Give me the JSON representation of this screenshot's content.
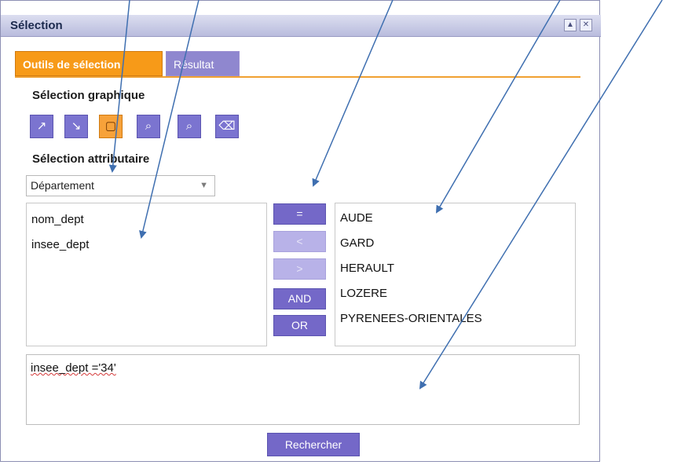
{
  "window": {
    "title": "Sélection",
    "minimize_icon": "▲",
    "close_icon": "✕"
  },
  "tabs": [
    {
      "label": "Outils de sélection",
      "active": true
    },
    {
      "label": "Résultat",
      "active": false
    }
  ],
  "graphic_section": {
    "title": "Sélection graphique",
    "tools": [
      {
        "icon": "point-select-icon",
        "glyph": "↗",
        "active": false
      },
      {
        "icon": "line-select-icon",
        "glyph": "↘",
        "active": false
      },
      {
        "icon": "rectangle-select-icon",
        "glyph": "▢",
        "active": true
      },
      {
        "icon": "polygon-select-icon",
        "glyph": "⌕",
        "active": false
      },
      {
        "icon": "freehand-select-icon",
        "glyph": "⌕",
        "active": false
      },
      {
        "icon": "eraser-icon",
        "glyph": "⌫",
        "active": false
      }
    ]
  },
  "attribute_section": {
    "title": "Sélection attributaire",
    "layer_select": {
      "value": "Département",
      "arrow": "▼"
    }
  },
  "fields": [
    "nom_dept",
    "insee_dept"
  ],
  "operators": [
    {
      "label": "=",
      "enabled": true
    },
    {
      "label": "<",
      "enabled": false
    },
    {
      "label": ">",
      "enabled": false
    },
    {
      "label": "AND",
      "enabled": true
    },
    {
      "label": "OR",
      "enabled": true
    }
  ],
  "values": [
    "AUDE",
    "GARD",
    "HERAULT",
    "LOZERE",
    "PYRENEES-ORIENTALES"
  ],
  "query": {
    "text": "insee_dept ='34'"
  },
  "search_button": {
    "label": "Rechercher"
  },
  "colors": {
    "accent": "#f79a18",
    "button": "#7468c8",
    "arrow": "#3f6fb0"
  }
}
